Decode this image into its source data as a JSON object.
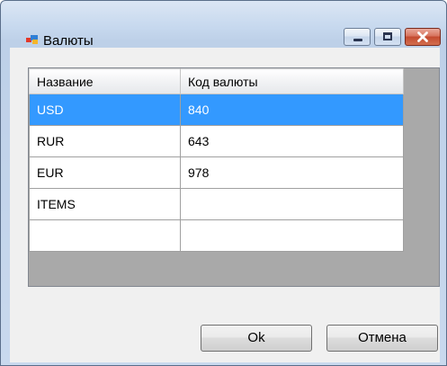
{
  "window": {
    "title": "Валюты",
    "icon": "window-app-icon",
    "caption_buttons": [
      "minimize-icon",
      "maximize-icon",
      "close-icon"
    ]
  },
  "grid": {
    "columns": [
      "Название",
      "Код валюты"
    ],
    "rows": [
      {
        "name": "USD",
        "code": "840",
        "selected": true
      },
      {
        "name": "RUR",
        "code": "643",
        "selected": false
      },
      {
        "name": "EUR",
        "code": "978",
        "selected": false
      },
      {
        "name": "ITEMS",
        "code": "",
        "selected": false
      },
      {
        "name": "",
        "code": "",
        "selected": false
      }
    ],
    "selection_color": "#3399ff"
  },
  "buttons": {
    "ok_label": "Ok",
    "cancel_label": "Отмена"
  }
}
